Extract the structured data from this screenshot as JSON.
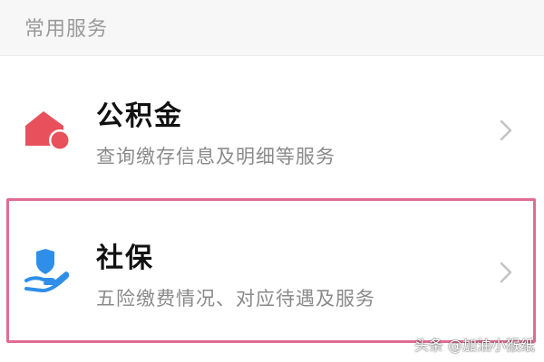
{
  "section": {
    "title": "常用服务"
  },
  "items": [
    {
      "title": "公积金",
      "description": "查询缴存信息及明细等服务",
      "icon": "house-icon",
      "icon_color": "#e8505b"
    },
    {
      "title": "社保",
      "description": "五险缴费情况、对应待遇及服务",
      "icon": "shield-hand-icon",
      "icon_color": "#2f8fe8",
      "highlighted": true
    }
  ],
  "colors": {
    "highlight_border": "#e06c93",
    "chevron": "#c4c4c4"
  },
  "watermark": "头条 @加油小猴纸"
}
